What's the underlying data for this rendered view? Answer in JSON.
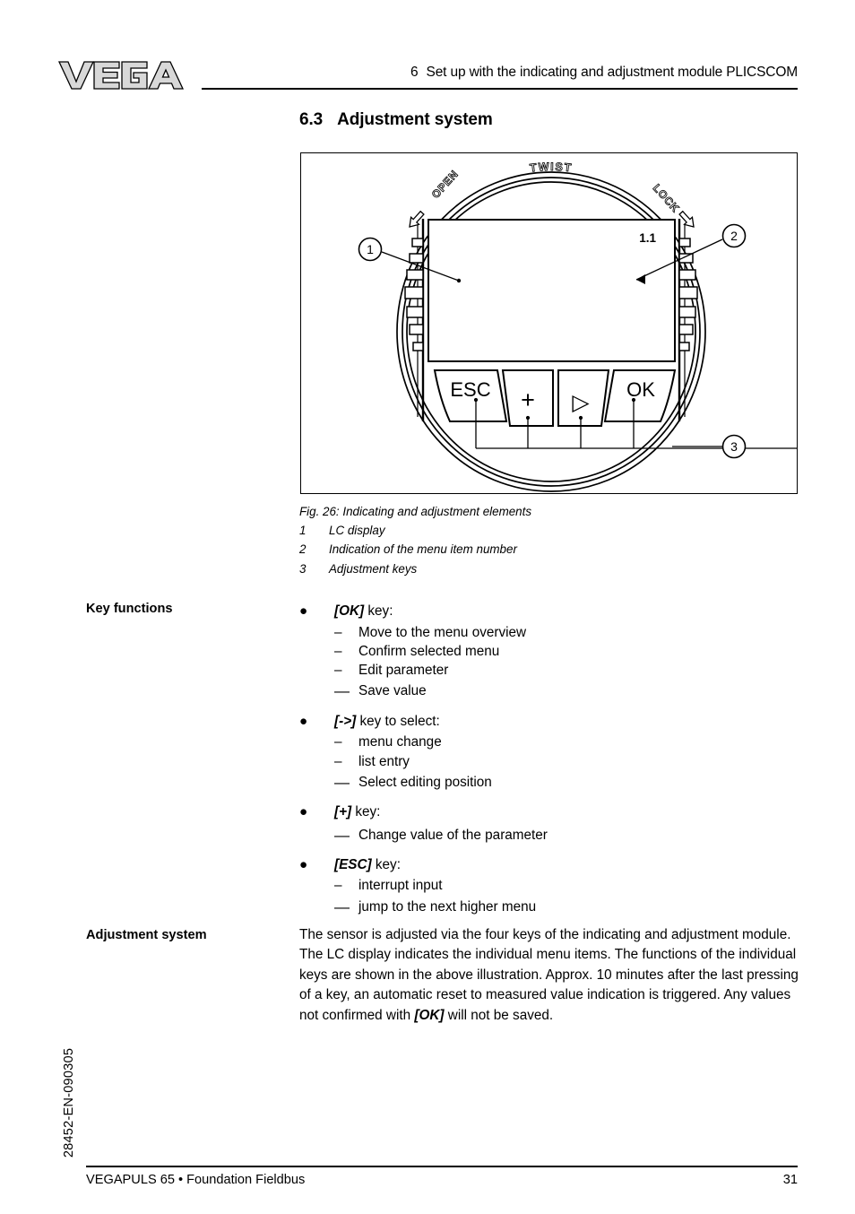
{
  "header": {
    "chapter_number": "6",
    "chapter_title": "Set up with the indicating and adjustment module PLICSCOM",
    "logo_text": "VEGA"
  },
  "section": {
    "number": "6.3",
    "title": "Adjustment system"
  },
  "figure": {
    "caption": "Fig. 26: Indicating and adjustment elements",
    "legend": [
      {
        "num": "1",
        "text": "LC display"
      },
      {
        "num": "2",
        "text": "Indication of the menu item number"
      },
      {
        "num": "3",
        "text": "Adjustment keys"
      }
    ],
    "device": {
      "twist_label": "TWIST",
      "open_label": "OPEN",
      "lock_label": "LOCK",
      "menu_item_number": "1.1",
      "keys": [
        {
          "id": "esc",
          "label": "ESC"
        },
        {
          "id": "plus",
          "label": "+"
        },
        {
          "id": "right",
          "label": "▷"
        },
        {
          "id": "ok",
          "label": "OK"
        }
      ],
      "callouts": [
        {
          "num": "1"
        },
        {
          "num": "2"
        },
        {
          "num": "3"
        }
      ]
    }
  },
  "key_functions": {
    "marginal_label": "Key functions",
    "bullet_char": "●",
    "groups": [
      {
        "key": "[OK]",
        "suffix": " key:",
        "items": [
          {
            "dash": "–",
            "text": "Move to the menu overview",
            "wide": false
          },
          {
            "dash": "–",
            "text": "Confirm selected menu",
            "wide": false
          },
          {
            "dash": "–",
            "text": "Edit parameter",
            "wide": false
          },
          {
            "dash": "—",
            "text": "Save value",
            "wide": true
          }
        ]
      },
      {
        "key": "[->]",
        "suffix": " key to select:",
        "items": [
          {
            "dash": "–",
            "text": "menu change",
            "wide": false
          },
          {
            "dash": "–",
            "text": "list entry",
            "wide": false
          },
          {
            "dash": "—",
            "text": "Select editing position",
            "wide": true
          }
        ]
      },
      {
        "key": "[+]",
        "suffix": " key:",
        "items": [
          {
            "dash": "—",
            "text": "Change value of the parameter",
            "wide": true
          }
        ]
      },
      {
        "key": "[ESC]",
        "suffix": " key:",
        "items": [
          {
            "dash": "–",
            "text": "interrupt input",
            "wide": false
          },
          {
            "dash": "—",
            "text": "jump to the next higher menu",
            "wide": true
          }
        ]
      }
    ]
  },
  "adjustment_system": {
    "marginal_label": "Adjustment system",
    "body_part1": "The sensor is adjusted via the four keys of the indicating and adjustment module. The LC display indicates the individual menu items. The functions of the individual keys are shown in the above illustration. Approx. 10 minutes after the last pressing of a key, an automatic reset to measured value indication is triggered. Any values not confirmed with ",
    "body_key": "[OK]",
    "body_part2": " will not be saved."
  },
  "doc_code": "28452-EN-090305",
  "footer": {
    "product": "VEGAPULS 65",
    "separator": "•",
    "protocol": "Foundation Fieldbus",
    "page_number": "31"
  }
}
